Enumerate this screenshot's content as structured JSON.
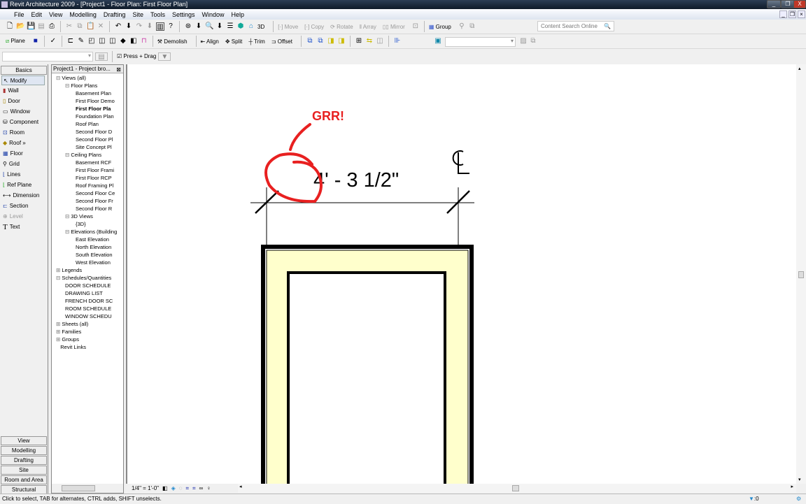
{
  "window": {
    "title": "Revit Architecture 2009 - [Project1 - Floor Plan: First Floor Plan]",
    "minimize": "_",
    "restore": "❐",
    "close": "X"
  },
  "menu": [
    "File",
    "Edit",
    "View",
    "Modelling",
    "Drafting",
    "Site",
    "Tools",
    "Settings",
    "Window",
    "Help"
  ],
  "toolbar1": {
    "view3d": "3D",
    "move": "Move",
    "copy": "Copy",
    "rotate": "Rotate",
    "array": "Array",
    "mirror": "Mirror",
    "group": "Group",
    "search_placeholder": "Content Search Online"
  },
  "toolbar2": {
    "plane": "Plane",
    "demolish": "Demolish",
    "align": "Align",
    "split": "Split",
    "trim": "Trim",
    "offset": "Offset"
  },
  "options": {
    "press_drag": "Press + Drag"
  },
  "design_bar": {
    "active_tab": "Basics",
    "tools": [
      "Modify",
      "Wall",
      "Door",
      "Window",
      "Component",
      "Room",
      "Roof »",
      "Floor",
      "Grid",
      "Lines",
      "Ref Plane",
      "Dimension",
      "Section",
      "Level",
      "Text"
    ],
    "tabs": [
      "View",
      "Modelling",
      "Drafting",
      "Site",
      "Room and Area",
      "Structural"
    ]
  },
  "browser": {
    "title": "Project1 - Project bro...",
    "tree": [
      {
        "t": "Views (all)",
        "l": 0
      },
      {
        "t": "Floor Plans",
        "l": 1
      },
      {
        "t": "Basement Plan",
        "l": 2
      },
      {
        "t": "First Floor Demo",
        "l": 2
      },
      {
        "t": "First Floor Pla",
        "l": 2,
        "b": true
      },
      {
        "t": "Foundation Plan",
        "l": 2
      },
      {
        "t": "Roof Plan",
        "l": 2
      },
      {
        "t": "Second Floor D",
        "l": 2
      },
      {
        "t": "Second Floor Pl",
        "l": 2
      },
      {
        "t": "Site Concept Pl",
        "l": 2
      },
      {
        "t": "Ceiling Plans",
        "l": 1
      },
      {
        "t": "Basement RCF",
        "l": 2
      },
      {
        "t": "First Floor Frami",
        "l": 2
      },
      {
        "t": "First Floor RCP",
        "l": 2
      },
      {
        "t": "Roof Framing Pl",
        "l": 2
      },
      {
        "t": "Second Floor Ce",
        "l": 2
      },
      {
        "t": "Second Floor Fr",
        "l": 2
      },
      {
        "t": "Second Floor R",
        "l": 2
      },
      {
        "t": "3D Views",
        "l": 1
      },
      {
        "t": "{3D}",
        "l": 2
      },
      {
        "t": "Elevations (Building",
        "l": 1
      },
      {
        "t": "East Elevation",
        "l": 2
      },
      {
        "t": "North Elevation",
        "l": 2
      },
      {
        "t": "South Elevation",
        "l": 2
      },
      {
        "t": "West Elevation",
        "l": 2
      },
      {
        "t": "Legends",
        "l": 0
      },
      {
        "t": "Schedules/Quantities",
        "l": 0
      },
      {
        "t": "DOOR SCHEDULE",
        "l": 1
      },
      {
        "t": "DRAWING LIST",
        "l": 1
      },
      {
        "t": "FRENCH DOOR SC",
        "l": 1
      },
      {
        "t": "ROOM SCHEDULE",
        "l": 1
      },
      {
        "t": "WINDOW SCHEDU",
        "l": 1
      },
      {
        "t": "Sheets (all)",
        "l": 0
      },
      {
        "t": "Families",
        "l": 0
      },
      {
        "t": "Groups",
        "l": 0
      },
      {
        "t": "Revit Links",
        "l": 0
      }
    ]
  },
  "drawing": {
    "dimension": "4' - 3 1/2\"",
    "annotation": "GRR!",
    "annotation_color": "#e82020",
    "wall_fill": "#ffffcc"
  },
  "view_bar": {
    "scale": "1/4\" = 1'-0\""
  },
  "status": {
    "text": "Click to select, TAB for alternates, CTRL adds, SHIFT unselects.",
    "filter_count": ":0"
  }
}
